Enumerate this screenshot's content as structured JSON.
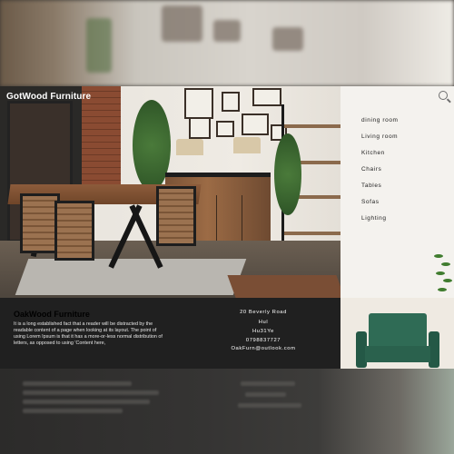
{
  "site": {
    "brand": "GotWood Furniture"
  },
  "nav": {
    "items": [
      {
        "label": "dining room"
      },
      {
        "label": "Living room"
      },
      {
        "label": "Kitchen"
      },
      {
        "label": "Chairs"
      },
      {
        "label": "Tables"
      },
      {
        "label": "Sofas"
      },
      {
        "label": "Lighting"
      }
    ],
    "search_icon": "search-icon"
  },
  "footer": {
    "title": "OakWood Furniture",
    "description": "It is a long established fact that a reader will be distracted by the readable content of a page when looking at its layout. The point of using Lorem Ipsum is that it has a more-or-less normal distribution of letters, as opposed to using 'Content here,",
    "address": {
      "street": "20 Beverly Road",
      "city": "Hul",
      "postcode": "Hu31Ye",
      "phone": "0798837727",
      "email": "OakFurn@outlook.com"
    }
  },
  "colors": {
    "footer_bg": "#202020",
    "nav_bg": "#f4f2ee",
    "armchair": "#2f6b55"
  }
}
